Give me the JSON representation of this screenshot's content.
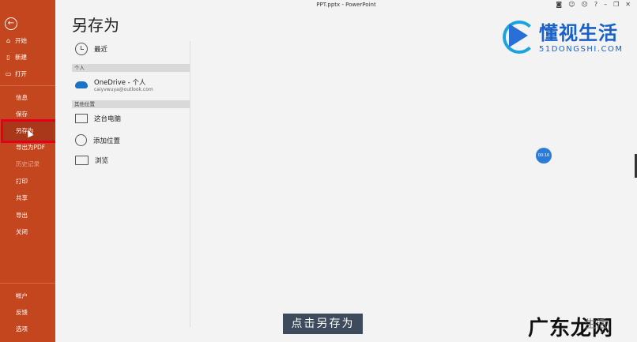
{
  "window": {
    "title": "PPT.pptx  -  PowerPoint"
  },
  "sidebar": {
    "back_icon": "arrow-left-icon",
    "items_top": [
      {
        "label": "开始",
        "icon": "home-icon"
      },
      {
        "label": "新建",
        "icon": "new-doc-icon"
      },
      {
        "label": "打开",
        "icon": "folder-open-icon"
      }
    ],
    "items_mid": [
      {
        "label": "信息"
      },
      {
        "label": "保存"
      },
      {
        "label": "另存为",
        "selected": true
      },
      {
        "label": "导出为PDF"
      },
      {
        "label": "历史记录",
        "disabled": true
      },
      {
        "label": "打印"
      },
      {
        "label": "共享"
      },
      {
        "label": "导出"
      },
      {
        "label": "关闭"
      }
    ],
    "items_bottom": [
      {
        "label": "帐户"
      },
      {
        "label": "反馈"
      },
      {
        "label": "选项"
      }
    ],
    "accent": "#c3461f",
    "highlight_color": "#e4001d"
  },
  "page": {
    "heading": "另存为"
  },
  "locations": {
    "recent": "最近",
    "personal_section": "个人",
    "onedrive_name": "OneDrive - 个人",
    "onedrive_email": "caiyvwuya@outlook.com",
    "other_section": "其他位置",
    "this_pc": "这台电脑",
    "add_place": "添加位置",
    "browse": "浏览"
  },
  "bubble": {
    "time": "00:16"
  },
  "caption": "点击另存为",
  "watermark_top": {
    "brand": "懂视生活",
    "domain": "51DONGSHI.COM"
  },
  "watermark_bottom": {
    "brand": "广东龙网",
    "sub": "生活"
  }
}
